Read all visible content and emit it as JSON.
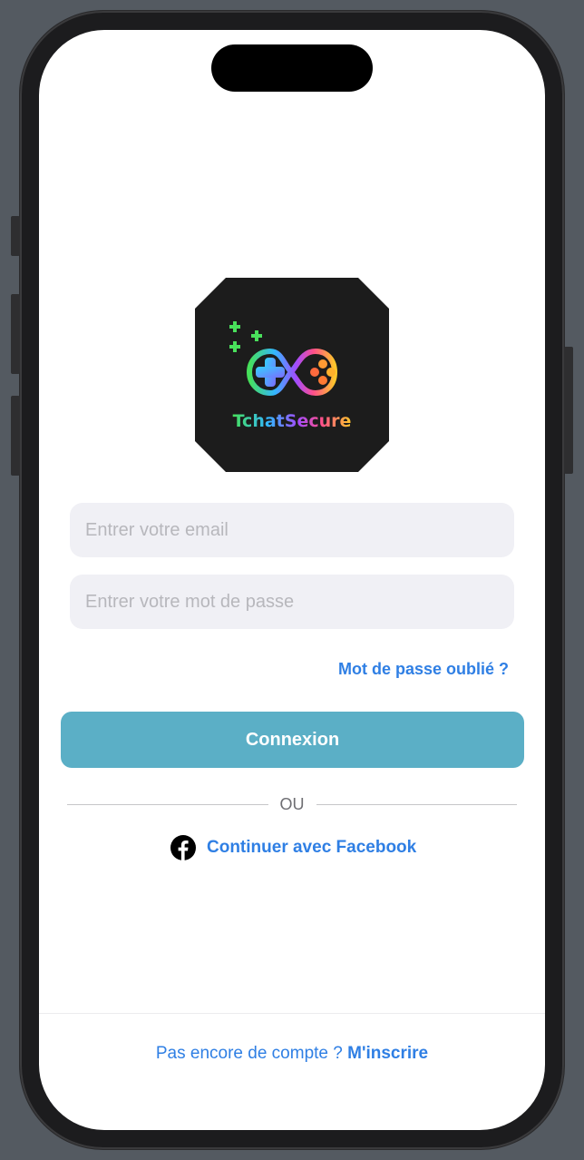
{
  "logo": {
    "brand_text": "TchatSecure",
    "background_color": "#1c1c1c"
  },
  "form": {
    "email_placeholder": "Entrer votre email",
    "email_value": "",
    "password_placeholder": "Entrer votre mot de passe",
    "password_value": "",
    "forgot_label": "Mot de passe oublié ?",
    "login_label": "Connexion"
  },
  "divider": {
    "label": "OU"
  },
  "social": {
    "facebook_icon": "facebook-icon",
    "facebook_label": "Continuer avec Facebook"
  },
  "footer": {
    "prompt": "Pas encore de compte ?",
    "signup_label": "M'inscrire"
  },
  "colors": {
    "accent": "#2f7fe4",
    "primary_button": "#5bafc6",
    "field_background": "#f0f0f5"
  }
}
